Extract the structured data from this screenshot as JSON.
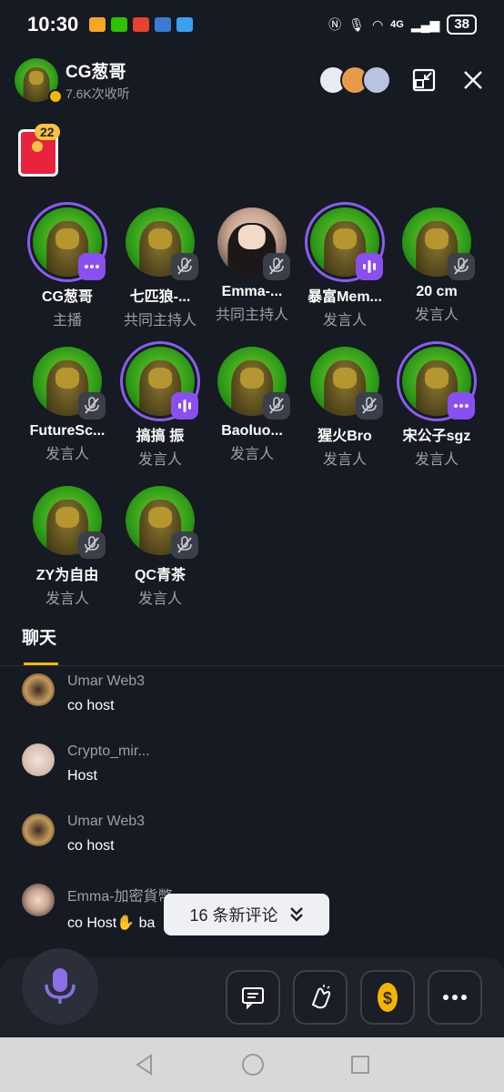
{
  "status_bar": {
    "time": "10:30",
    "network": "4G",
    "battery": "38"
  },
  "header": {
    "host_name": "CG葱哥",
    "listens": "7.6K次收听"
  },
  "red_packet": {
    "count": "22"
  },
  "speakers": [
    {
      "name": "CG葱哥",
      "role": "主播",
      "state": "more",
      "ring": true,
      "photo": false
    },
    {
      "name": "七匹狼-...",
      "role": "共同主持人",
      "state": "muted",
      "ring": false,
      "photo": false
    },
    {
      "name": "Emma-...",
      "role": "共同主持人",
      "state": "muted",
      "ring": false,
      "photo": true
    },
    {
      "name": "暴富Mem...",
      "role": "发言人",
      "state": "speaking",
      "ring": true,
      "photo": false
    },
    {
      "name": "20 cm",
      "role": "发言人",
      "state": "muted",
      "ring": false,
      "photo": false
    },
    {
      "name": "FutureSc...",
      "role": "发言人",
      "state": "muted",
      "ring": false,
      "photo": false
    },
    {
      "name": "搞搞  振",
      "role": "发言人",
      "state": "speaking",
      "ring": true,
      "photo": false
    },
    {
      "name": "Baoluo...",
      "role": "发言人",
      "state": "muted",
      "ring": false,
      "photo": false
    },
    {
      "name": "猩火Bro",
      "role": "发言人",
      "state": "muted",
      "ring": false,
      "photo": false
    },
    {
      "name": "宋公子sgz",
      "role": "发言人",
      "state": "more",
      "ring": true,
      "photo": false
    },
    {
      "name": "ZY为自由",
      "role": "发言人",
      "state": "muted",
      "ring": false,
      "photo": false
    },
    {
      "name": "QC青茶",
      "role": "发言人",
      "state": "muted",
      "ring": false,
      "photo": false
    }
  ],
  "chat": {
    "tab_label": "聊天",
    "messages": [
      {
        "user": "Umar Web3",
        "text": "co host"
      },
      {
        "user": "Crypto_mir...",
        "text": "Host"
      },
      {
        "user": "Umar Web3",
        "text": "co host"
      },
      {
        "user": "Emma-加密貨幣",
        "text": "co Host✋ ba"
      }
    ],
    "new_comments": "16 条新评论"
  },
  "colors": {
    "accent": "#8a4ff0",
    "brand": "#f4b500",
    "background": "#161a22"
  }
}
